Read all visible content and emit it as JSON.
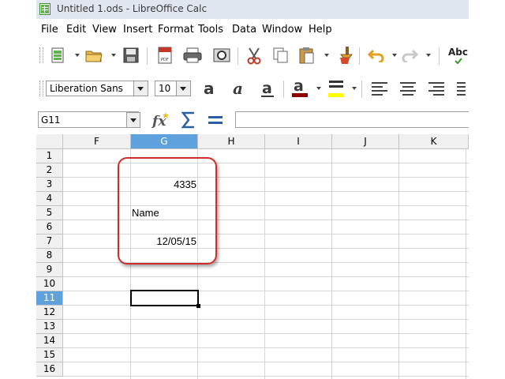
{
  "window": {
    "title": "Untitled 1.ods - LibreOffice Calc"
  },
  "menu": [
    "File",
    "Edit",
    "View",
    "Insert",
    "Format",
    "Tools",
    "Data",
    "Window",
    "Help"
  ],
  "toolbar": {
    "font_name": "Liberation Sans",
    "font_size": "10",
    "partial_label": "Abc"
  },
  "formula_bar": {
    "name_box": "G11",
    "input": ""
  },
  "sheet": {
    "columns": [
      "F",
      "G",
      "H",
      "I",
      "J",
      "K"
    ],
    "selected_column": "G",
    "rows": [
      "1",
      "2",
      "3",
      "4",
      "5",
      "6",
      "7",
      "8",
      "9",
      "10",
      "11",
      "12",
      "13",
      "14",
      "15",
      "16"
    ],
    "selected_row": "11",
    "cells": {
      "G3": "4335",
      "G5": "Name",
      "G7": "12/05/15"
    },
    "active_cell": "G11"
  },
  "colors": {
    "header_selected": "#5fa1dd",
    "annotation": "#d02b2b",
    "font_color_bar": "#8b0000",
    "highlight_bar": "#ffff00"
  }
}
